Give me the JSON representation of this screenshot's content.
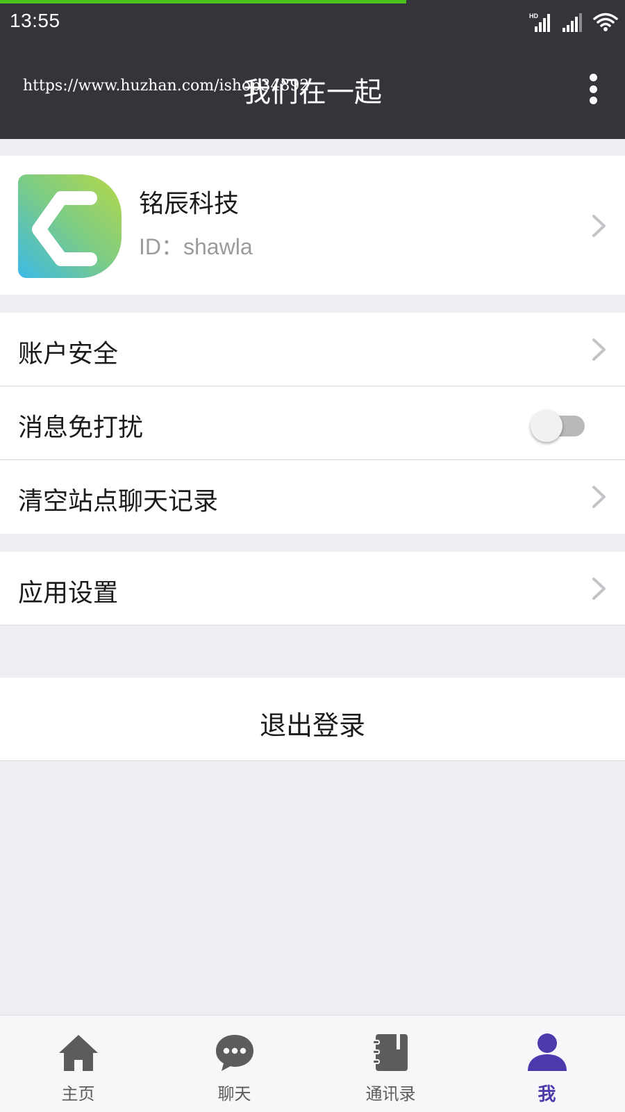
{
  "status_bar": {
    "time": "13:55",
    "hd_badge": "HD",
    "icons": [
      "hd-signal-icon",
      "signal-icon",
      "wifi-icon"
    ]
  },
  "app_bar": {
    "watermark_url": "https://www.huzhan.com/ishop34892",
    "title": "我们在一起",
    "more_icon": "more-vertical-icon"
  },
  "profile": {
    "name": "铭辰科技",
    "id_text": "ID：shawla"
  },
  "menu": {
    "account_security": "账户安全",
    "do_not_disturb": "消息免打扰",
    "do_not_disturb_on": false,
    "clear_chat": "清空站点聊天记录",
    "app_settings": "应用设置"
  },
  "logout": {
    "label": "退出登录"
  },
  "tabs": [
    {
      "label": "主页",
      "icon": "home-icon",
      "active": false
    },
    {
      "label": "聊天",
      "icon": "chat-icon",
      "active": false
    },
    {
      "label": "通讯录",
      "icon": "contacts-icon",
      "active": false
    },
    {
      "label": "我",
      "icon": "user-icon",
      "active": true
    }
  ],
  "colors": {
    "header": "#33353b",
    "progress": "#4cc21b",
    "accent": "#4b3aac",
    "background": "#eeeef2"
  }
}
